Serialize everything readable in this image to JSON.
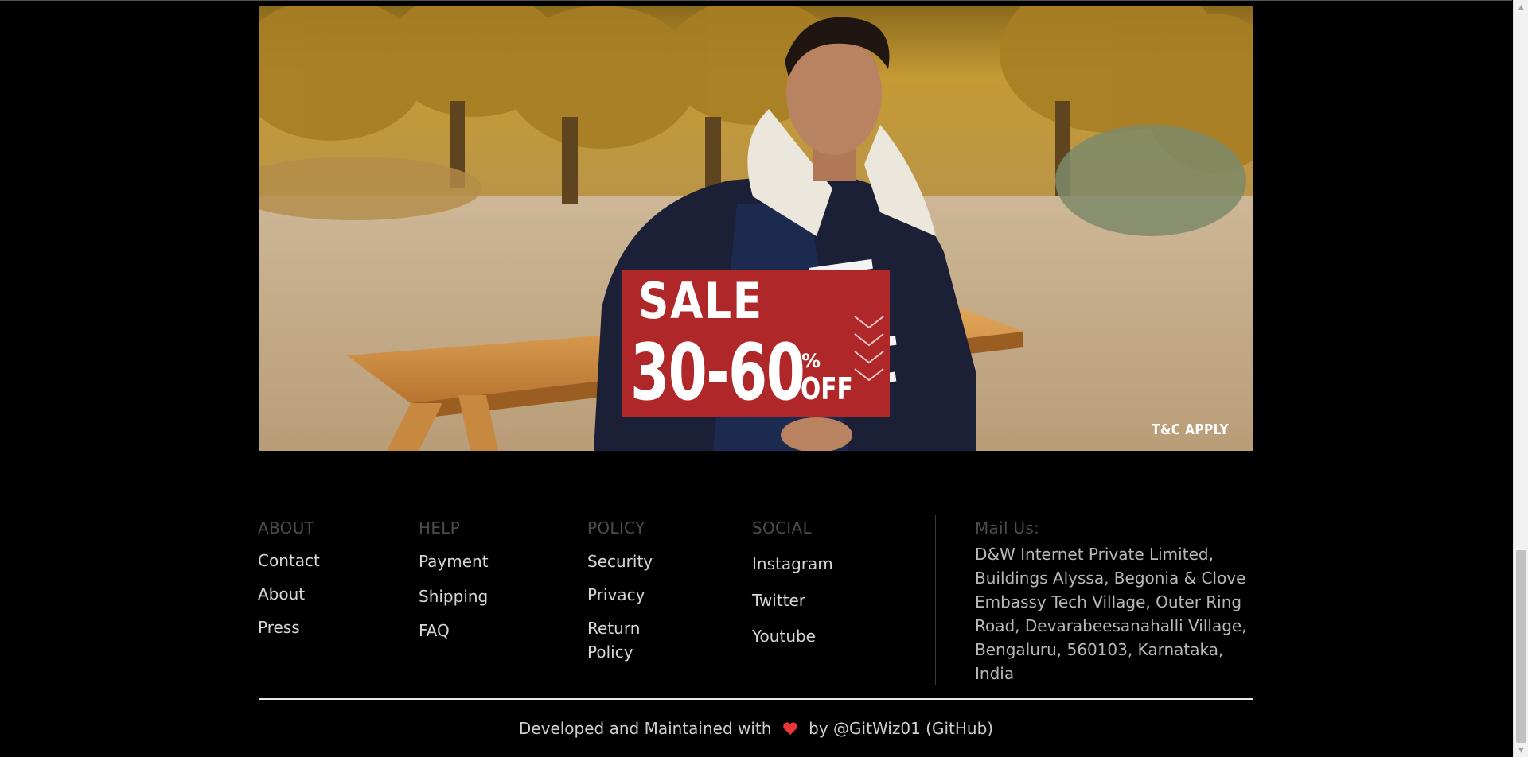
{
  "banner": {
    "sale_word": "SALE",
    "discount_range": "30-60",
    "percent_sign": "%",
    "off_word": "OFF",
    "terms": "T&C APPLY",
    "accent_color": "#b0272a"
  },
  "footer": {
    "about": {
      "title": "ABOUT",
      "links": [
        "Contact",
        "About",
        "Press"
      ]
    },
    "help": {
      "title": "HELP",
      "links": [
        "Payment",
        "Shipping",
        "FAQ"
      ]
    },
    "policy": {
      "title": "POLICY",
      "links": [
        "Security",
        "Privacy",
        "Return Policy"
      ]
    },
    "social": {
      "title": "SOCIAL",
      "links": [
        "Instagram",
        "Twitter",
        "Youtube"
      ]
    },
    "mail": {
      "title": "Mail Us:",
      "address": "D&W Internet Private Limited,\nBuildings Alyssa, Begonia & Clove\nEmbassy Tech Village, Outer Ring\nRoad, Devarabeesanahalli Village,\nBengaluru, 560103, Karnataka,\nIndia"
    }
  },
  "credits": {
    "prefix": "Developed and Maintained with",
    "suffix": "by @GitWiz01 (GitHub)",
    "heart_color": "#e8343a"
  }
}
